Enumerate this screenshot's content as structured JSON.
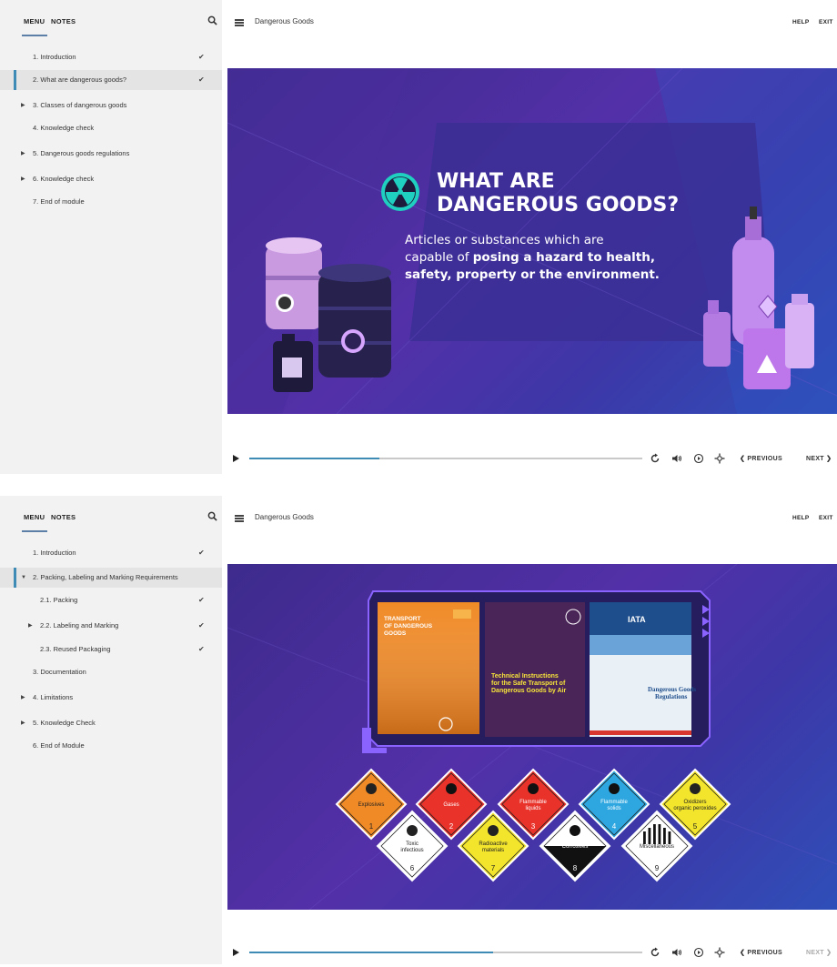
{
  "screens": [
    {
      "sidebar": {
        "tab_menu": "MENU",
        "tab_notes": "NOTES",
        "items": [
          {
            "label": "1. Introduction"
          },
          {
            "label": "2. What are dangerous goods?"
          },
          {
            "label": "3. Classes of dangerous goods"
          },
          {
            "label": "4. Knowledge check"
          },
          {
            "label": "5. Dangerous goods regulations"
          },
          {
            "label": "6. Knowledge check"
          },
          {
            "label": "7. End of module"
          }
        ]
      },
      "header": {
        "title": "Dangerous Goods",
        "help": "HELP",
        "exit": "EXIT"
      },
      "slide": {
        "title_line1": "WHAT ARE",
        "title_line2": "DANGEROUS GOODS?",
        "body_line1": "Articles or substances which are",
        "body_line2_plain": "capable of ",
        "body_line2_bold": "posing a hazard to health,",
        "body_line3_bold": "safety, property or the environment."
      },
      "controls": {
        "progress": 0.33,
        "previous": "PREVIOUS",
        "next": "NEXT"
      }
    },
    {
      "sidebar": {
        "tab_menu": "MENU",
        "tab_notes": "NOTES",
        "items": [
          {
            "label": "1. Introduction"
          },
          {
            "label": "2. Packing, Labeling and Marking Requirements"
          },
          {
            "label": "2.1. Packing"
          },
          {
            "label": "2.2. Labeling and Marking"
          },
          {
            "label": "2.3. Reused Packaging"
          },
          {
            "label": "3. Documentation"
          },
          {
            "label": "4. Limitations"
          },
          {
            "label": "5. Knowledge Check"
          },
          {
            "label": "6. End of Module"
          }
        ]
      },
      "header": {
        "title": "Dangerous Goods",
        "help": "HELP",
        "exit": "EXIT"
      },
      "slide": {
        "book1": {
          "line1": "TRANSPORT",
          "line2": "OF DANGEROUS",
          "line3": "GOODS"
        },
        "book2": {
          "line1": "Technical Instructions",
          "line2": "for the Safe Transport of",
          "line3": "Dangerous Goods by Air"
        },
        "book3": {
          "logo": "IATA",
          "line1": "Dangerous Goods",
          "line2": "Regulations"
        },
        "labels": [
          {
            "text": "Explosives",
            "num": "1"
          },
          {
            "text": "Gases",
            "num": "2"
          },
          {
            "text": "Flammable liquids",
            "num": "3"
          },
          {
            "text": "Flammable solids",
            "num": "4"
          },
          {
            "text": "Oxidizers organic peroxides",
            "num": "5"
          },
          {
            "text": "Toxic infectious",
            "num": "6"
          },
          {
            "text": "Radioactive materials",
            "num": "7"
          },
          {
            "text": "Corrosives",
            "num": "8"
          },
          {
            "text": "Miscellaneous",
            "num": "9"
          }
        ]
      },
      "controls": {
        "progress": 0.62,
        "previous": "PREVIOUS",
        "next": "NEXT"
      }
    }
  ],
  "colors": {
    "accent": "#3e8bb5",
    "slide_bg": "#4b2fa0"
  },
  "icons": [
    "search-icon",
    "check-icon",
    "caret-icon",
    "hamburger-icon",
    "play-icon",
    "replay-icon",
    "volume-icon",
    "captions-icon",
    "settings-icon",
    "chevron-left-icon",
    "chevron-right-icon",
    "radiation-icon"
  ]
}
